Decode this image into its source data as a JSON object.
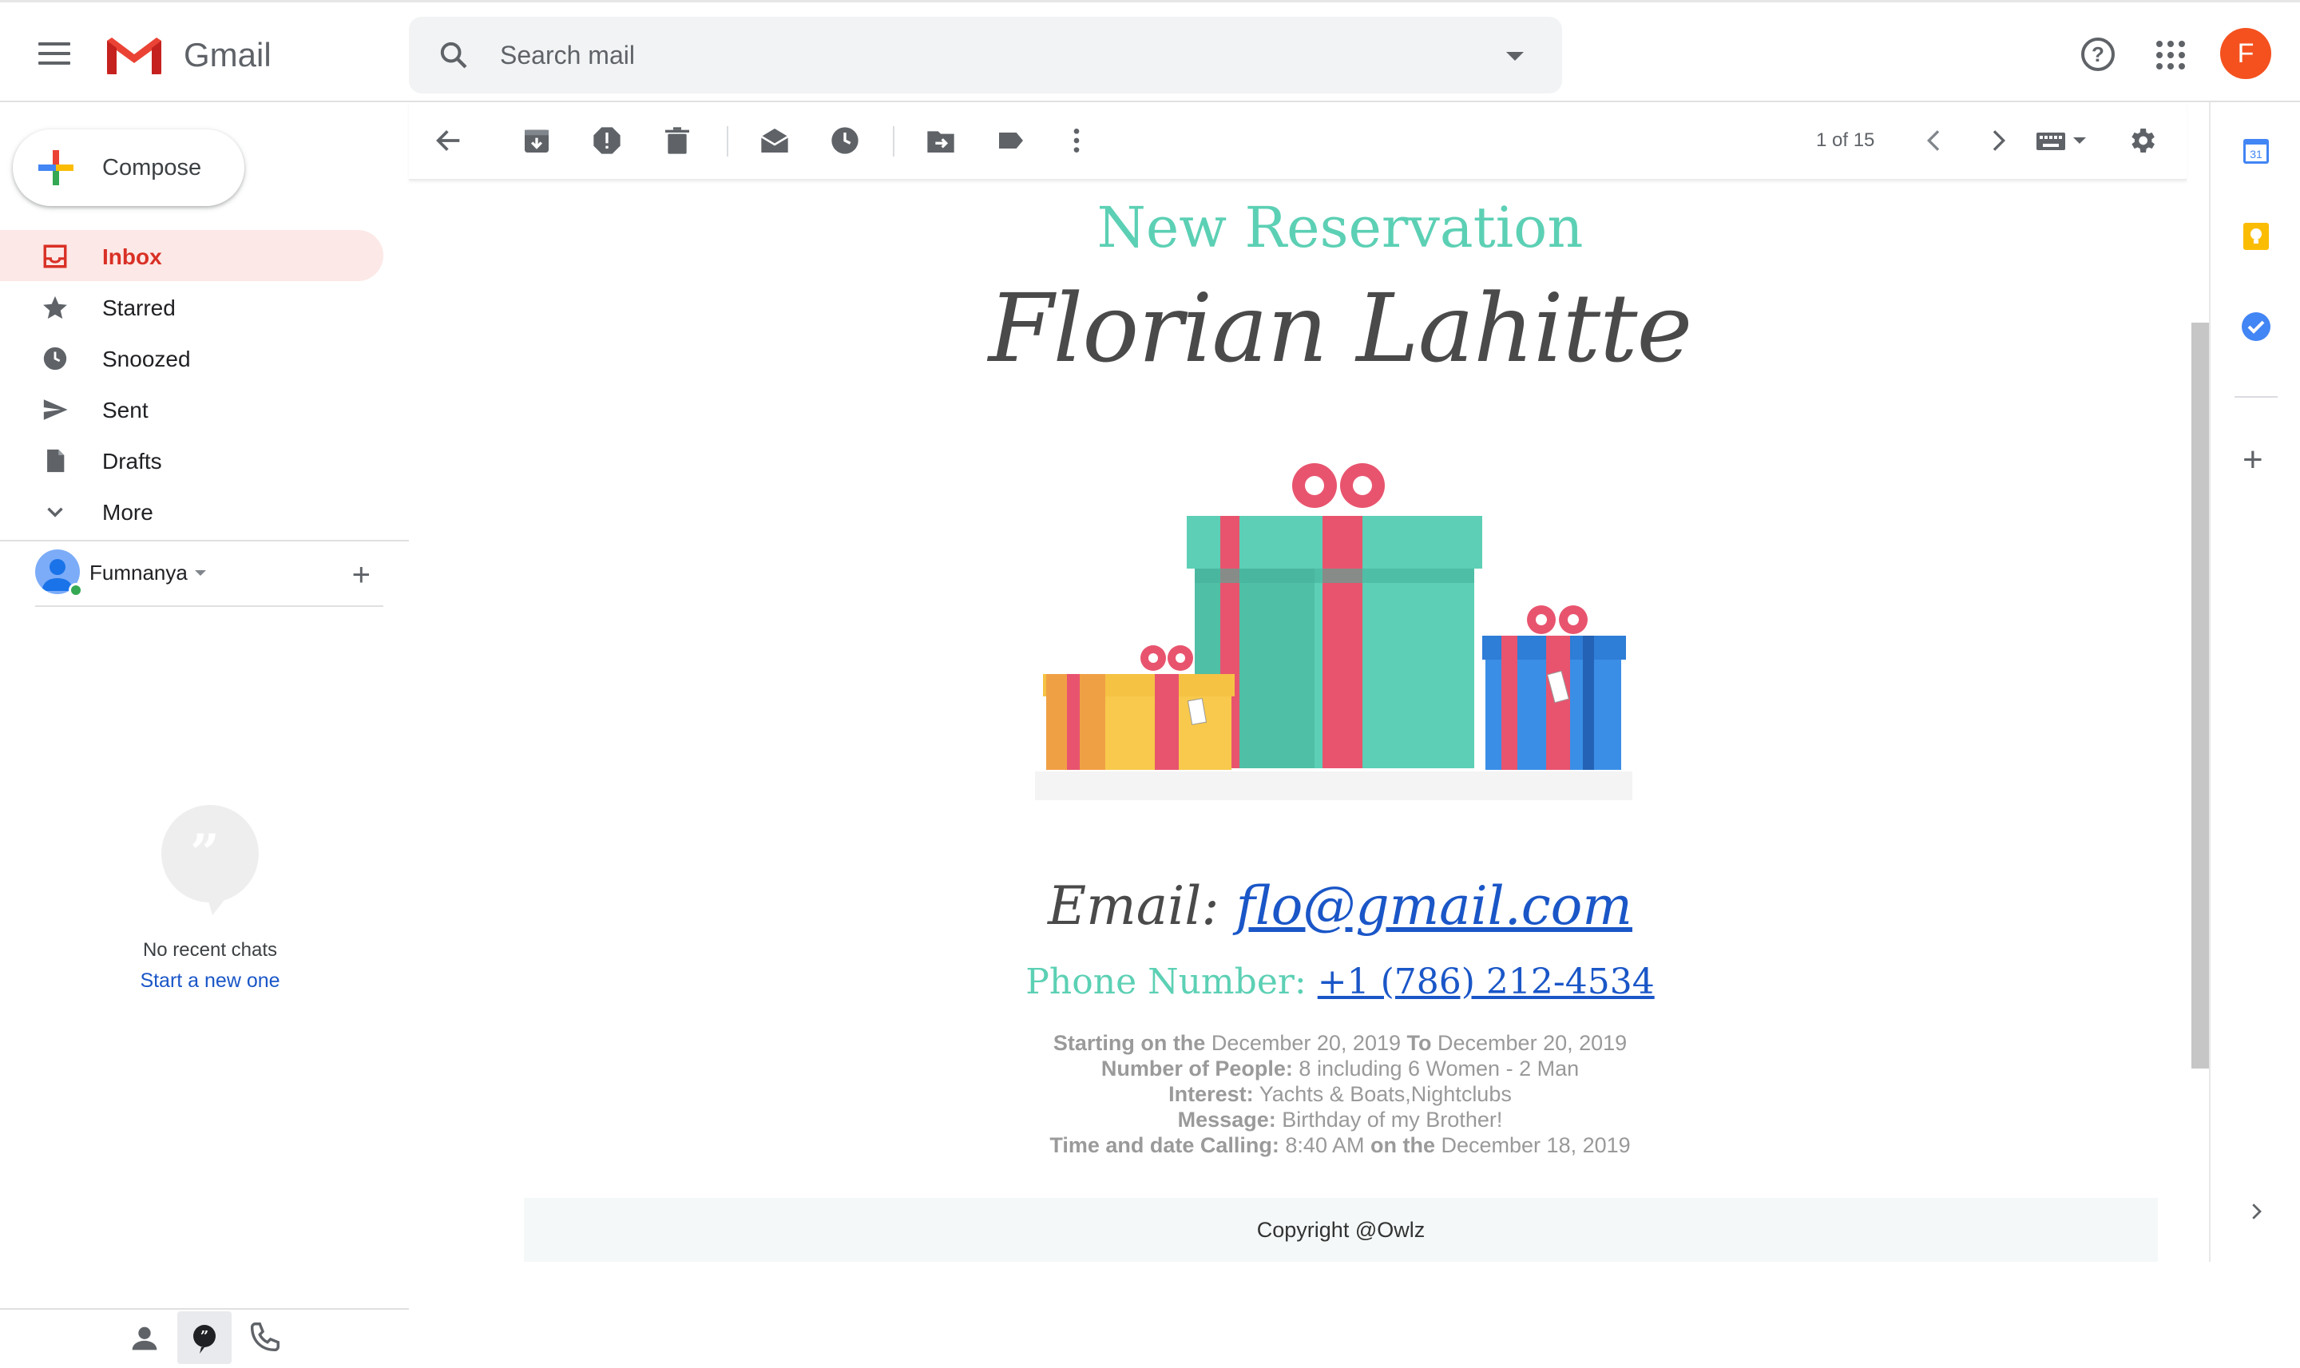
{
  "app": {
    "name": "Gmail",
    "user_initial": "F",
    "accent": "#d93025"
  },
  "search": {
    "placeholder": "Search mail"
  },
  "compose": {
    "label": "Compose"
  },
  "nav": [
    {
      "label": "Inbox",
      "icon": "inbox-icon",
      "active": true
    },
    {
      "label": "Starred",
      "icon": "star-icon",
      "active": false
    },
    {
      "label": "Snoozed",
      "icon": "clock-icon",
      "active": false
    },
    {
      "label": "Sent",
      "icon": "send-icon",
      "active": false
    },
    {
      "label": "Drafts",
      "icon": "draft-icon",
      "active": false
    },
    {
      "label": "More",
      "icon": "chevron-down-icon",
      "active": false
    }
  ],
  "account": {
    "name": "Fumnanya"
  },
  "hangouts": {
    "empty_text": "No recent chats",
    "start_link": "Start a new one"
  },
  "toolbar": {
    "pager": "1 of 15"
  },
  "email": {
    "title": "New Reservation",
    "name": "Florian Lahitte",
    "email_label": "Email:",
    "email_value": "flo@gmail.com",
    "phone_label": "Phone Number:",
    "phone_value": "+1 (786) 212-4534",
    "starting_label": "Starting on the",
    "start_date": "December 20, 2019",
    "to_label": "To",
    "end_date": "December 20, 2019",
    "people_label": "Number of People:",
    "people_value": "8 including 6 Women - 2 Man",
    "interest_label": "Interest:",
    "interest_value": "Yachts & Boats,Nightclubs",
    "message_label": "Message:",
    "message_value": "Birthday of my Brother!",
    "calling_label": "Time and date Calling:",
    "calling_time": "8:40 AM",
    "on_the_label": "on the",
    "calling_date": "December 18, 2019",
    "footer": "Copyright @Owlz"
  },
  "colors": {
    "title_teal": "#5cd0b4",
    "link_blue": "#1a56c7",
    "avatar_orange": "#f4511e"
  }
}
